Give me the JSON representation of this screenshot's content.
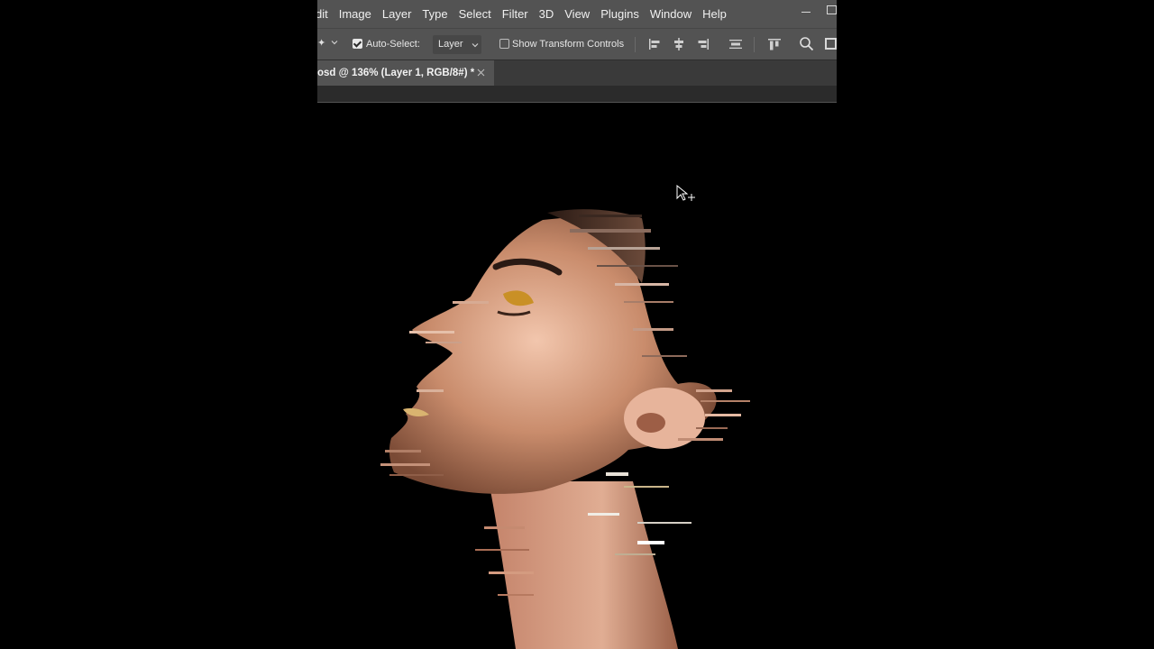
{
  "menu": {
    "items": [
      "dit",
      "Image",
      "Layer",
      "Type",
      "Select",
      "Filter",
      "3D",
      "View",
      "Plugins",
      "Window",
      "Help"
    ]
  },
  "options": {
    "auto_select_checked": true,
    "auto_select_label": "Auto-Select:",
    "layer_dropdown_value": "Layer",
    "show_transform_checked": false,
    "show_transform_label": "Show Transform Controls"
  },
  "tab": {
    "title": "osd @ 136% (Layer 1, RGB/8#) *"
  },
  "colors": {
    "ui_bar": "#535353",
    "tab_bar": "#3a3a3a",
    "canvas_bg": "#000000",
    "text": "#f0f0f0"
  },
  "icons": {
    "tool": "move-tool-icon",
    "search": "search-icon",
    "cursor": "move-cursor-icon"
  }
}
